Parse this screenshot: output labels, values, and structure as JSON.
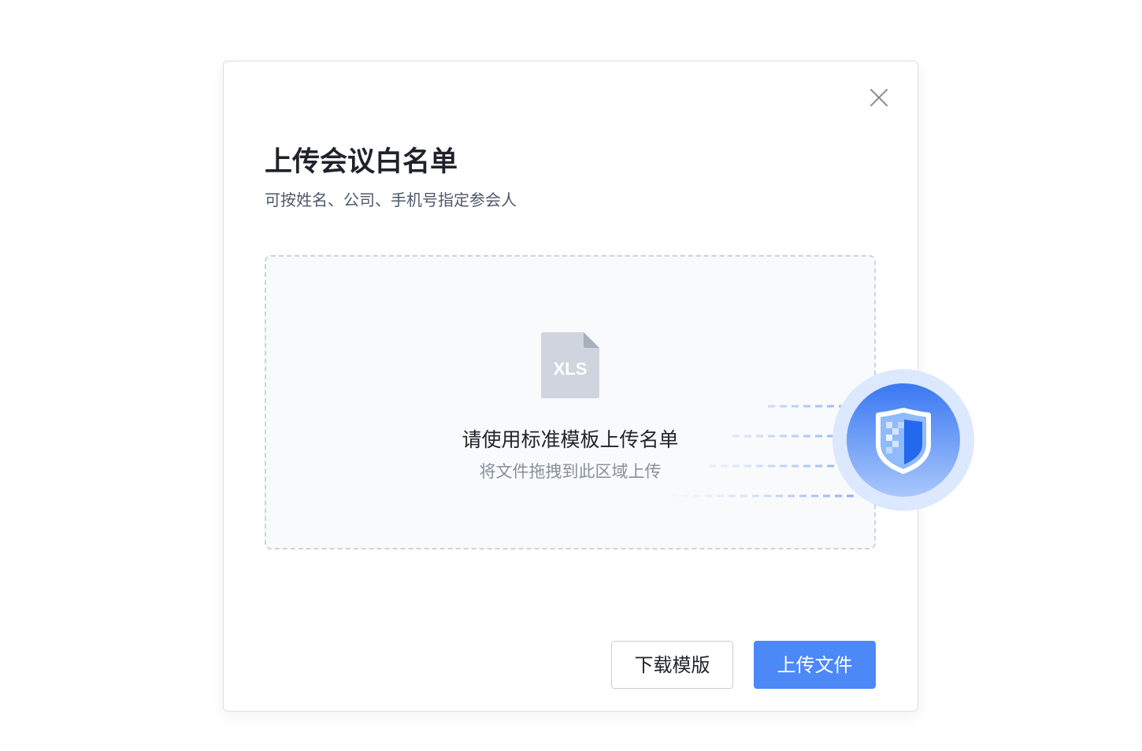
{
  "dialog": {
    "title": "上传会议白名单",
    "subtitle": "可按姓名、公司、手机号指定参会人"
  },
  "upload_area": {
    "file_type_label": "XLS",
    "primary_text": "请使用标准模板上传名单",
    "secondary_text": "将文件拖拽到此区域上传"
  },
  "actions": {
    "download_template_label": "下载模版",
    "upload_file_label": "上传文件"
  },
  "icons": {
    "close": "close-icon",
    "file": "xls-file-icon",
    "badge": "shield-icon"
  },
  "colors": {
    "primary": "#4d88f7",
    "text_primary": "#1f2329",
    "text_secondary": "#86909c",
    "dropzone_background": "#f9fafc",
    "dropzone_border": "#cfd3da"
  }
}
